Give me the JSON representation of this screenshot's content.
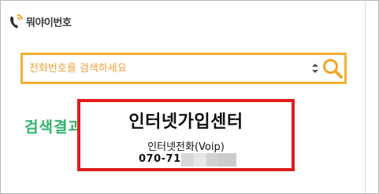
{
  "header": {
    "logo_text": "뭐야이번호",
    "logo_icon": "phone-handset-icon"
  },
  "search": {
    "placeholder": "전화번호를 검색하세요",
    "value": "",
    "button_icon": "search-icon"
  },
  "result": {
    "label": "검색결과",
    "business_name": "인터넷가입센터",
    "business_type": "인터넷전화(Voip)",
    "phone_visible": "070-71"
  },
  "colors": {
    "accent_orange": "#f2b134",
    "result_green": "#2fb56a",
    "highlight_red": "#e21c1c"
  }
}
